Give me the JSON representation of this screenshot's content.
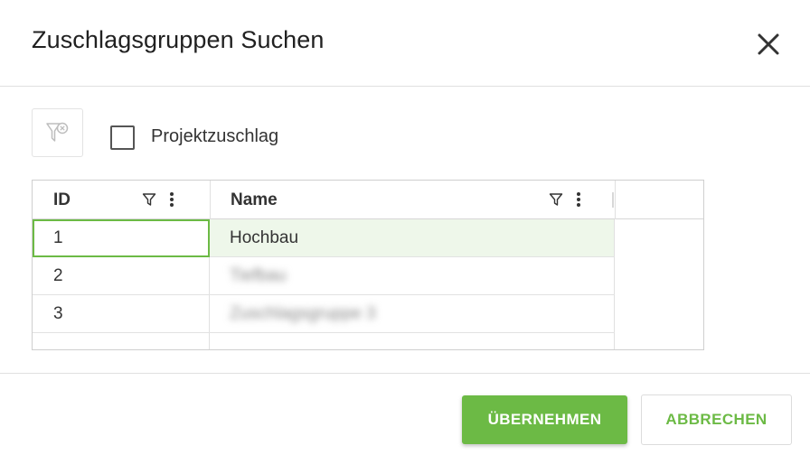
{
  "dialog": {
    "title": "Zuschlagsgruppen Suchen"
  },
  "toolbar": {
    "filter_button_icon": "filter-clear-icon",
    "checkbox_label": "Projektzuschlag",
    "checkbox_checked": false
  },
  "grid": {
    "columns": [
      {
        "label": "ID"
      },
      {
        "label": "Name"
      }
    ],
    "rows": [
      {
        "id": "1",
        "name": "Hochbau",
        "selected": true
      },
      {
        "id": "2",
        "name": "Tiefbau"
      },
      {
        "id": "3",
        "name": "Zuschlagsgruppe 3"
      }
    ]
  },
  "footer": {
    "apply_label": "ÜBERNEHMEN",
    "cancel_label": "ABBRECHEN"
  },
  "colors": {
    "accent": "#6cba45",
    "selected_row": "#eef7ea"
  }
}
